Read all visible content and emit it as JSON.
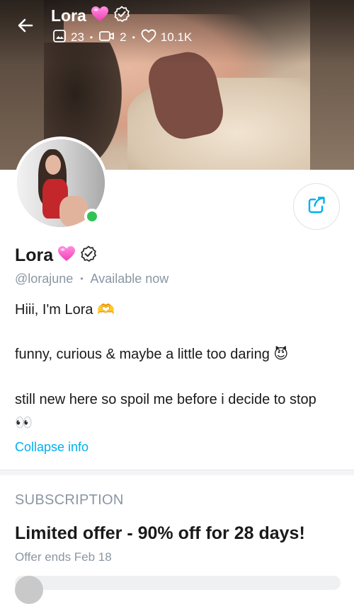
{
  "header": {
    "name": "Lora",
    "stats": {
      "photos": "23",
      "videos": "2",
      "likes": "10.1K"
    }
  },
  "profile": {
    "name": "Lora",
    "handle": "@lorajune",
    "status": "Available now",
    "online": true,
    "bio": {
      "line1": "Hiii, I'm Lora 🫶",
      "line2": "funny, curious & maybe a little too daring 😈",
      "line3": "still new here so spoil me before i decide to stop",
      "line4": "👀"
    },
    "collapse_label": "Collapse info"
  },
  "subscription": {
    "section_title": "SUBSCRIPTION",
    "offer_title": "Limited offer - 90% off for 28 days!",
    "offer_ends": "Offer ends Feb 18"
  },
  "colors": {
    "accent": "#00aff0",
    "online": "#31c254",
    "muted": "#8a96a3",
    "heart_pink": "#ff5fc8"
  },
  "icons": {
    "back": "arrow-left-icon",
    "heart_badge": "pink-heart-icon",
    "verified": "verified-badge-icon",
    "photos": "image-icon",
    "videos": "video-icon",
    "likes": "heart-outline-icon",
    "share": "share-icon"
  }
}
